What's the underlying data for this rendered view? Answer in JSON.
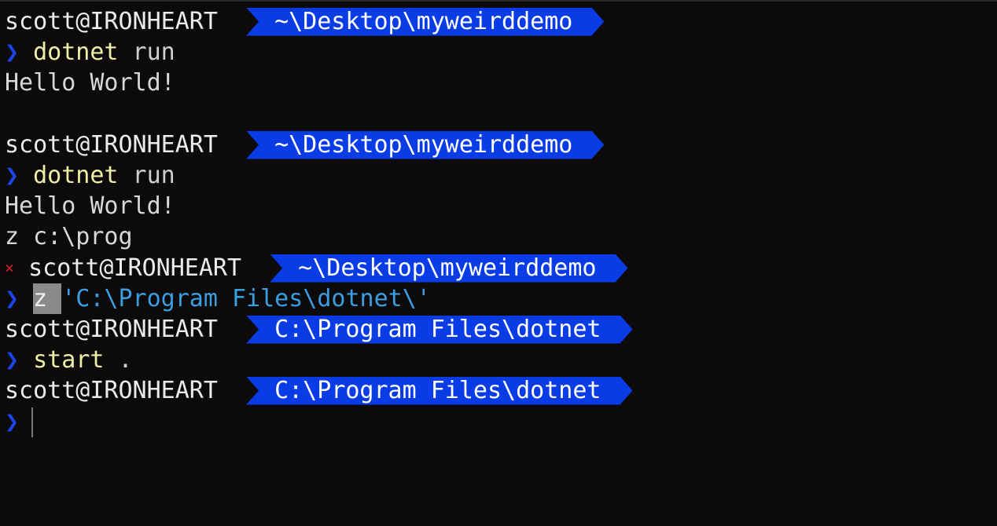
{
  "colors": {
    "background": "#0c0a0b",
    "path_segment": "#0a3ce6",
    "prompt_chevron": "#1d44e8",
    "command": "#eeeea6",
    "string": "#3b9ee0",
    "error": "#d21f2c"
  },
  "prompt": {
    "chevron": "❯",
    "error_mark": "×"
  },
  "lines": [
    {
      "user": "scott@IRONHEART",
      "path": "~\\Desktop\\myweirddemo"
    },
    {
      "command": "dotnet",
      "args": " run"
    },
    {
      "output": "Hello World!"
    },
    {
      "user": "scott@IRONHEART",
      "path": "~\\Desktop\\myweirddemo"
    },
    {
      "command": "dotnet",
      "args": " run"
    },
    {
      "output": "Hello World!"
    },
    {
      "output": "z c:\\prog"
    },
    {
      "user": "scott@IRONHEART",
      "path": "~\\Desktop\\myweirddemo"
    },
    {
      "command": "z",
      "args": "'C:\\Program Files\\dotnet\\'"
    },
    {
      "user": "scott@IRONHEART",
      "path": "C:\\Program Files\\dotnet"
    },
    {
      "command": "start",
      "args": " ."
    },
    {
      "user": "scott@IRONHEART",
      "path": "C:\\Program Files\\dotnet"
    }
  ]
}
